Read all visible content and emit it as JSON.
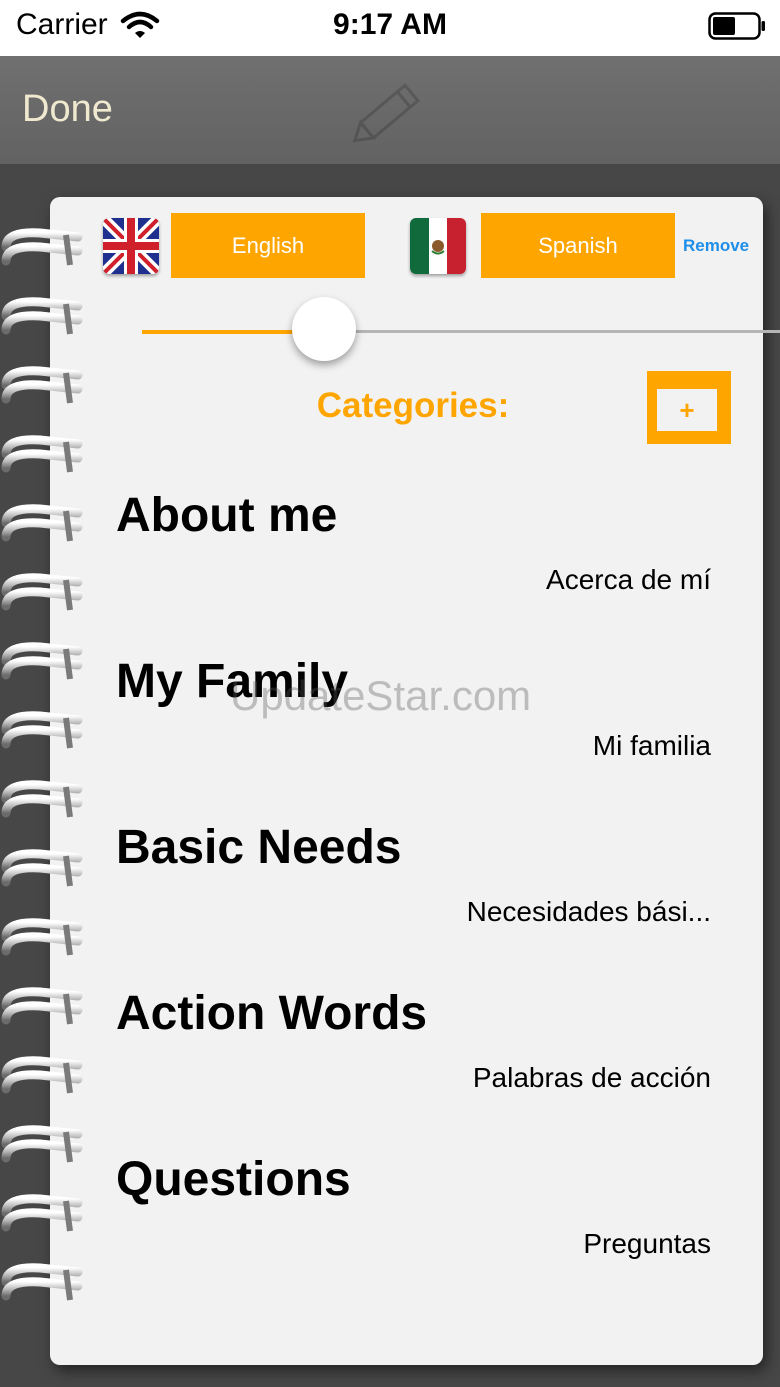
{
  "status_bar": {
    "carrier": "Carrier",
    "time": "9:17 AM"
  },
  "nav": {
    "done_label": "Done"
  },
  "languages": {
    "source": {
      "label": "English",
      "flag_icon": "uk-flag-icon"
    },
    "target": {
      "label": "Spanish",
      "flag_icon": "mexico-flag-icon"
    },
    "remove_label": "Remove"
  },
  "slider": {
    "value": 0.35
  },
  "categories": {
    "title": "Categories:",
    "add_label": "+",
    "items": [
      {
        "en": "About me",
        "es": "Acerca de mí"
      },
      {
        "en": "My Family",
        "es": "Mi familia"
      },
      {
        "en": "Basic Needs",
        "es": "Necesidades bási..."
      },
      {
        "en": "Action Words",
        "es": "Palabras de acción"
      },
      {
        "en": "Questions",
        "es": "Preguntas"
      }
    ]
  },
  "watermark": "UpdateStar.com",
  "colors": {
    "accent": "#ffa500",
    "link": "#1e8ee8",
    "page": "#f2f2f2"
  }
}
